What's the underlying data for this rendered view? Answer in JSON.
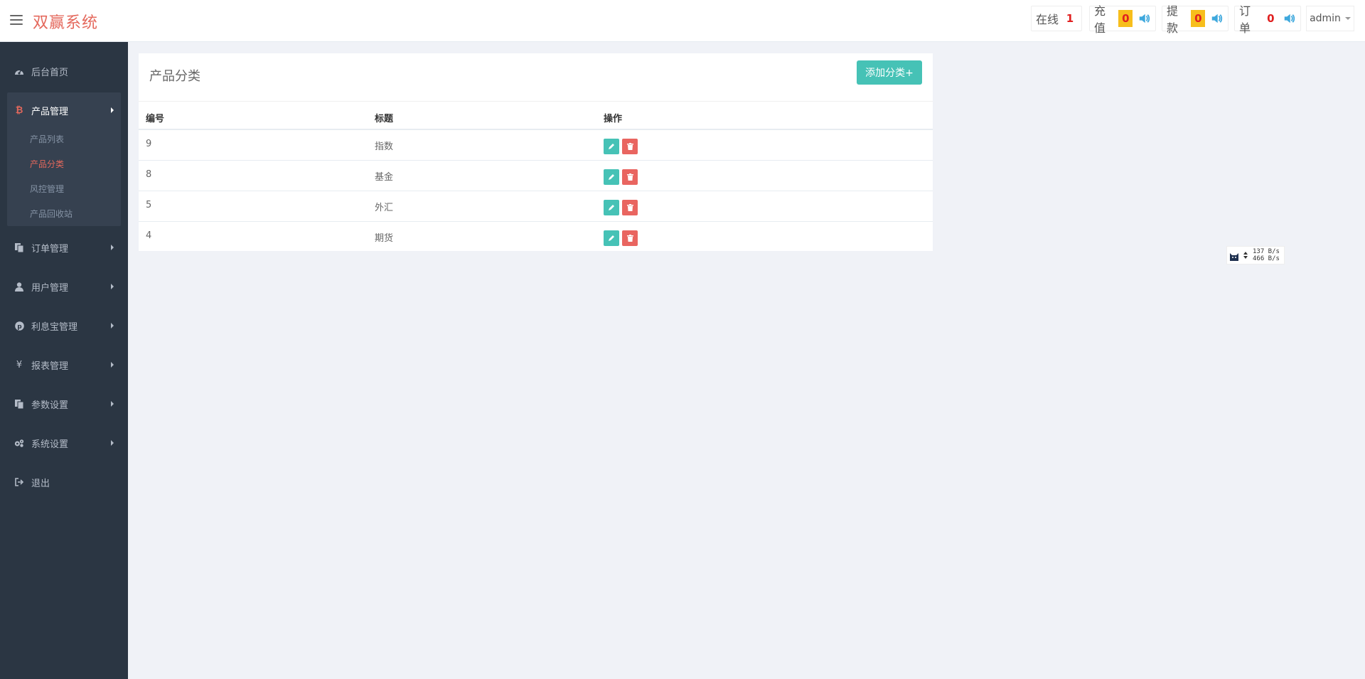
{
  "header": {
    "brand": "双赢系统",
    "stats": [
      {
        "label": "在线",
        "count": "1",
        "style": "white",
        "speaker": false
      },
      {
        "label": "充值",
        "count": "0",
        "style": "yellow",
        "speaker": true
      },
      {
        "label": "提款",
        "count": "0",
        "style": "yellow",
        "speaker": true
      },
      {
        "label": "订单",
        "count": "0",
        "style": "white",
        "speaker": true
      }
    ],
    "user": "admin"
  },
  "sidebar": {
    "items": [
      {
        "label": "后台首页",
        "icon": "dashboard-icon"
      },
      {
        "label": "产品管理",
        "icon": "bitcoin-icon"
      },
      {
        "label": "订单管理",
        "icon": "copy-icon"
      },
      {
        "label": "用户管理",
        "icon": "user-icon"
      },
      {
        "label": "利息宝管理",
        "icon": "pinterest-icon"
      },
      {
        "label": "报表管理",
        "icon": "yen-icon"
      },
      {
        "label": "参数设置",
        "icon": "copy-icon"
      },
      {
        "label": "系统设置",
        "icon": "cogs-icon"
      },
      {
        "label": "退出",
        "icon": "sign-out-icon"
      }
    ],
    "submenu": [
      {
        "label": "产品列表"
      },
      {
        "label": "产品分类"
      },
      {
        "label": "风控管理"
      },
      {
        "label": "产品回收站"
      }
    ]
  },
  "panel": {
    "title": "产品分类",
    "add_label": "添加分类+",
    "columns": [
      "编号",
      "标题",
      "操作"
    ],
    "rows": [
      {
        "id": "9",
        "title": "指数"
      },
      {
        "id": "8",
        "title": "基金"
      },
      {
        "id": "5",
        "title": "外汇"
      },
      {
        "id": "4",
        "title": "期货"
      }
    ]
  },
  "speed": {
    "up": "137 B/s",
    "down": "466 B/s"
  },
  "colors": {
    "brand": "#e4685c",
    "sidebar": "#2b3643",
    "accent": "#46c2b6",
    "danger": "#e96560",
    "badge": "#f7be1c"
  }
}
